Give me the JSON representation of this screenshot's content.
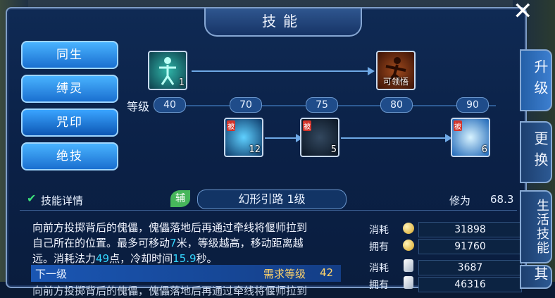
{
  "window": {
    "title": "技能",
    "close_glyph": "✕"
  },
  "side_tabs": [
    {
      "label": "同生",
      "active": false
    },
    {
      "label": "缚灵",
      "active": false
    },
    {
      "label": "咒印",
      "active": true
    },
    {
      "label": "绝技",
      "active": false
    }
  ],
  "right_tabs": [
    {
      "label": "升级",
      "active": true
    },
    {
      "label": "更换",
      "active": false
    },
    {
      "label": "生活技能",
      "active": false
    },
    {
      "label": "其",
      "active": false
    }
  ],
  "tree": {
    "level_label": "等级",
    "levels": [
      "40",
      "70",
      "75",
      "80",
      "90"
    ],
    "nodes": [
      {
        "id": "root",
        "num": "1",
        "passive": false
      },
      {
        "id": "learnable",
        "caption": "可领悟",
        "passive": false
      },
      {
        "id": "skill-70",
        "num": "12",
        "passive": true,
        "passive_label": "被"
      },
      {
        "id": "skill-75",
        "num": "5",
        "passive": true,
        "passive_label": "被"
      },
      {
        "id": "skill-90",
        "num": "6",
        "passive": true,
        "passive_label": "被"
      }
    ]
  },
  "detail": {
    "section_label": "技能详情",
    "badge": "辅",
    "skill_name": "幻形引路 1级",
    "cultivation_label": "修为",
    "cultivation_value": "68.3",
    "desc_line1": "向前方投掷背后的傀儡，傀儡落地后再通过牵线将偃师拉到",
    "desc_line2_pre": "自己所在的位置。最多可移动",
    "move_value": "7",
    "desc_line2_post": "米，等级越高，移动距离越",
    "desc_line3_pre": "远。消耗法力",
    "mana_value": "49",
    "desc_line3_mid": "点，冷却时间",
    "cd_value": "15.9",
    "desc_line3_post": "秒。",
    "next_label": "下一级",
    "req_label": "需求等级",
    "req_value": "42",
    "cut_line": "向前方投掷背后的傀儡，傀儡落地后再通过牵线将偃师拉到"
  },
  "costs": [
    {
      "label": "消耗",
      "icon": "gold-coin-icon",
      "value": "31898"
    },
    {
      "label": "拥有",
      "icon": "gold-coin-icon",
      "value": "91760"
    },
    {
      "label": "消耗",
      "icon": "feather-icon",
      "value": "3687"
    },
    {
      "label": "拥有",
      "icon": "feather-icon",
      "value": "46316"
    }
  ]
}
